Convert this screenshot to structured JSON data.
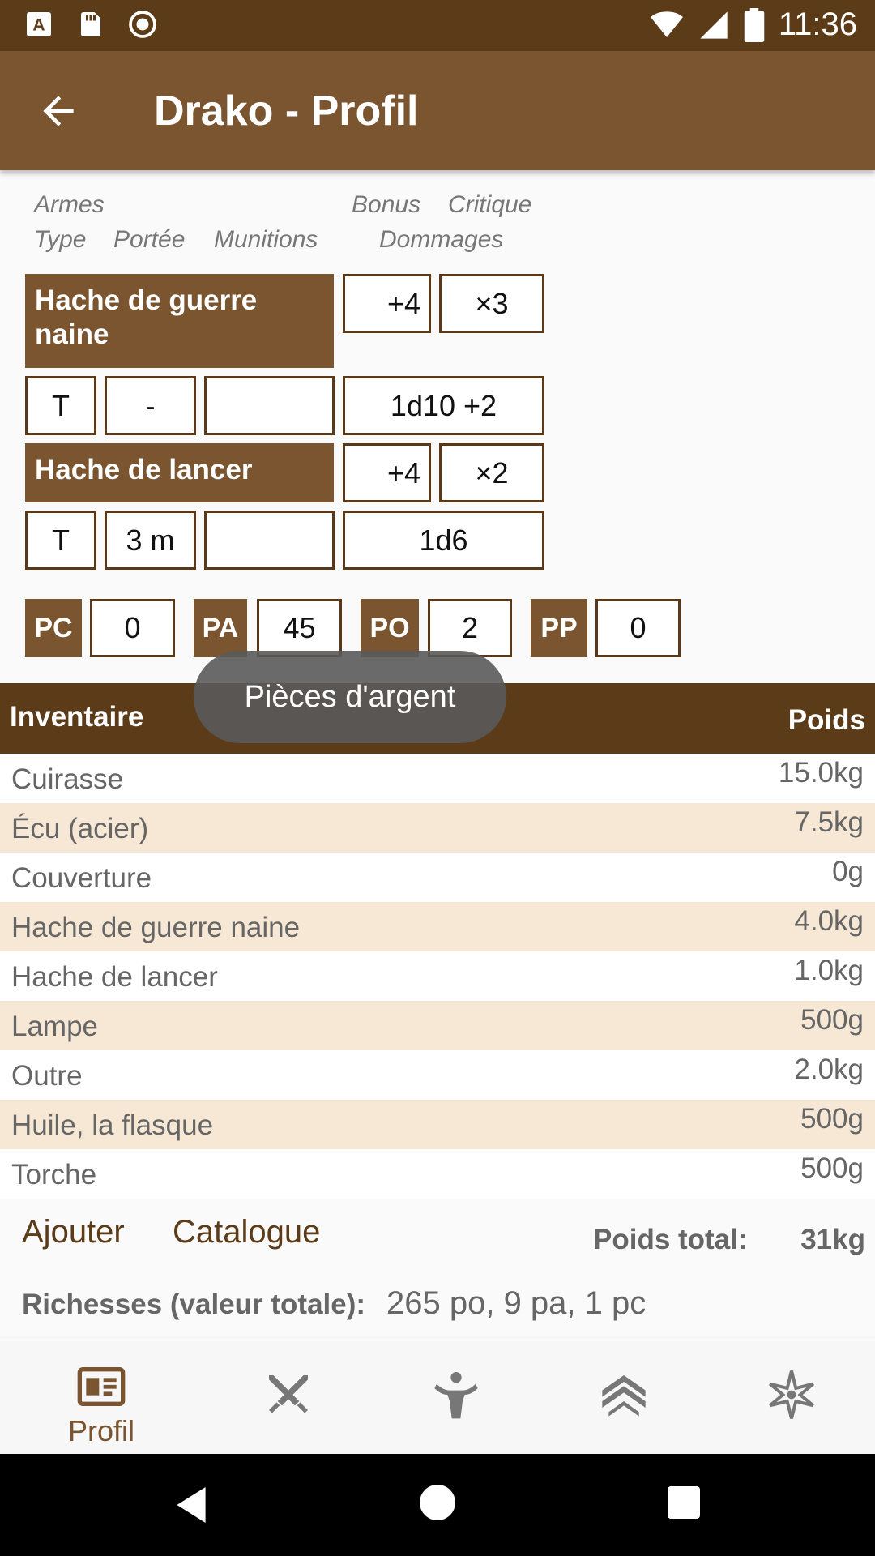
{
  "statusbar": {
    "time": "11:36"
  },
  "appbar": {
    "title": "Drako - Profil"
  },
  "weapons_header": {
    "armes": "Armes",
    "type": "Type",
    "portee": "Portée",
    "munitions": "Munitions",
    "bonus": "Bonus",
    "critique": "Critique",
    "dommages": "Dommages"
  },
  "weapons": [
    {
      "name": "Hache de guerre naine",
      "bonus": "+4",
      "critique": "×3",
      "type": "T",
      "portee": "-",
      "munitions": "",
      "dommages": "1d10 +2"
    },
    {
      "name": "Hache de lancer",
      "bonus": "+4",
      "critique": "×2",
      "type": "T",
      "portee": "3 m",
      "munitions": "",
      "dommages": "1d6"
    }
  ],
  "money": [
    {
      "label": "PC",
      "value": "0"
    },
    {
      "label": "PA",
      "value": "45"
    },
    {
      "label": "PO",
      "value": "2"
    },
    {
      "label": "PP",
      "value": "0"
    }
  ],
  "inventory": {
    "title": "Inventaire",
    "weight_header": "Poids",
    "items": [
      {
        "name": "Cuirasse",
        "weight": "15.0kg"
      },
      {
        "name": "Écu (acier)",
        "weight": "7.5kg"
      },
      {
        "name": "Couverture",
        "weight": "0g"
      },
      {
        "name": "Hache de guerre naine",
        "weight": "4.0kg"
      },
      {
        "name": "Hache de lancer",
        "weight": "1.0kg"
      },
      {
        "name": "Lampe",
        "weight": "500g"
      },
      {
        "name": "Outre",
        "weight": "2.0kg"
      },
      {
        "name": "Huile, la flasque",
        "weight": "500g"
      },
      {
        "name": "Torche",
        "weight": "500g"
      }
    ],
    "add_label": "Ajouter",
    "catalog_label": "Catalogue",
    "total_weight_label": "Poids total:",
    "total_weight_value": "31kg",
    "wealth_label": "Richesses (valeur totale):",
    "wealth_value": "265 po, 9 pa, 1 pc"
  },
  "toast": "Pièces d'argent",
  "bottom_nav": [
    {
      "label": "Profil",
      "icon": "profile-card-icon",
      "active": true
    },
    {
      "label": "",
      "icon": "crossed-weapons-icon"
    },
    {
      "label": "",
      "icon": "strength-figure-icon"
    },
    {
      "label": "",
      "icon": "rank-chevrons-icon"
    },
    {
      "label": "",
      "icon": "magic-star-icon"
    }
  ],
  "colors": {
    "primary": "#7a5530",
    "dark": "#5c3b18",
    "row_alt": "#f7e8d6"
  }
}
